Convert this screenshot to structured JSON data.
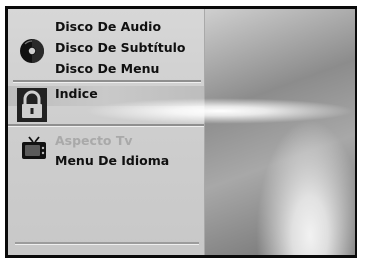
{
  "menu": {
    "audio_group": {
      "icon": "disc-icon",
      "items": [
        {
          "label": "Disco De Audio"
        },
        {
          "label": "Disco De Subtítulo"
        },
        {
          "label": "Disco De Menu"
        }
      ]
    },
    "lock_group": {
      "icon": "lock-icon",
      "label": "Indice"
    },
    "tv_group": {
      "icon": "tv-icon",
      "items": [
        {
          "label": "Aspecto Tv",
          "state": "disabled"
        },
        {
          "label": "Menu De Idioma"
        }
      ]
    }
  },
  "colors": {
    "panel": "#d0d0d0",
    "text": "#101010",
    "disabled_text": "#a9a9a9",
    "frame": "#0a0a0a"
  }
}
